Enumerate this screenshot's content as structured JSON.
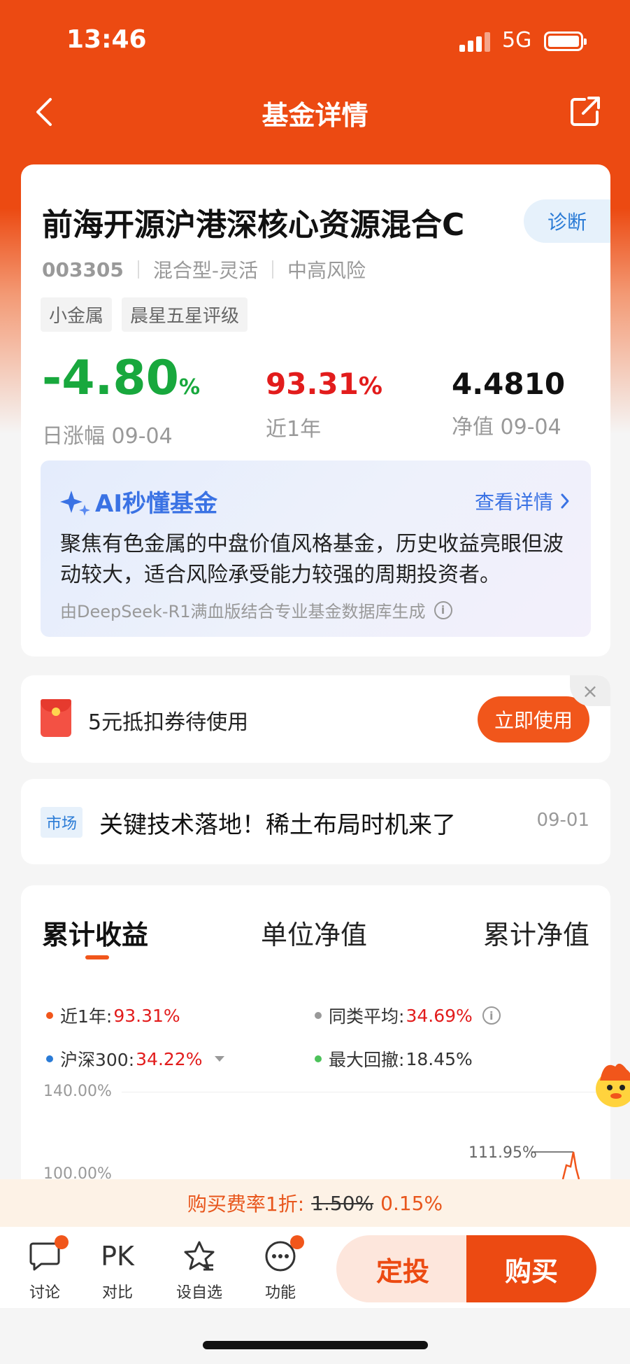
{
  "status": {
    "time": "13:46",
    "network": "5G"
  },
  "nav": {
    "title": "基金详情",
    "back_icon": "chevron-left-icon",
    "share_icon": "share-icon"
  },
  "fund": {
    "name": "前海开源沪港深核心资源混合C",
    "diagnose": "诊断",
    "code": "003305",
    "type": "混合型-灵活",
    "risk": "中高风险",
    "tags": [
      "小金属",
      "晨星五星评级"
    ],
    "daily_change": "-4.80",
    "daily_change_unit": "%",
    "daily_label": "日涨幅 09-04",
    "year_return": "93.31",
    "year_return_unit": "%",
    "year_label": "近1年",
    "nav": "4.4810",
    "nav_label": "净值 09-04"
  },
  "ai": {
    "title": "AI秒懂基金",
    "more": "查看详情",
    "summary": "聚焦有色金属的中盘价值风格基金，历史收益亮眼但波动较大，适合风险承受能力较强的周期投资者。",
    "footnote": "由DeepSeek-R1满血版结合专业基金数据库生成"
  },
  "coupon": {
    "text": "5元抵扣券待使用",
    "button": "立即使用",
    "close": "×"
  },
  "news": {
    "tag": "市场",
    "title": "关键技术落地！稀土布局时机来了",
    "date": "09-01"
  },
  "chart": {
    "tabs": [
      "累计收益",
      "单位净值",
      "累计净值"
    ],
    "active_tab": 0,
    "legend": [
      {
        "label": "近1年:",
        "value": "93.31%",
        "color": "#f1561b"
      },
      {
        "label": "同类平均:",
        "value": "34.69%",
        "color": "#999999"
      },
      {
        "label": "沪深300:",
        "value": "34.22%",
        "color": "#2a7bd6"
      },
      {
        "label": "最大回撤:",
        "value": "18.45%",
        "color": "#4cc25a"
      }
    ],
    "y_ticks": [
      "140.00%",
      "100.00%"
    ],
    "annotation": "111.95%"
  },
  "chart_data": {
    "type": "line",
    "title": "",
    "ylabel": "",
    "y_ticks": [
      "140.00%",
      "100.00%"
    ],
    "series": [
      {
        "name": "近1年",
        "values": [
          111.95
        ],
        "color": "#f1561b"
      }
    ]
  },
  "fee": {
    "prefix": "购买费率1折:",
    "original": "1.50%",
    "discounted": "0.15%"
  },
  "bottom": {
    "items": [
      {
        "label": "讨论",
        "icon": "chat-icon"
      },
      {
        "label": "对比",
        "icon": "pk-icon",
        "glyph": "PK"
      },
      {
        "label": "设自选",
        "icon": "star-icon"
      },
      {
        "label": "功能",
        "icon": "more-icon"
      }
    ],
    "invest": "定投",
    "buy": "购买"
  }
}
